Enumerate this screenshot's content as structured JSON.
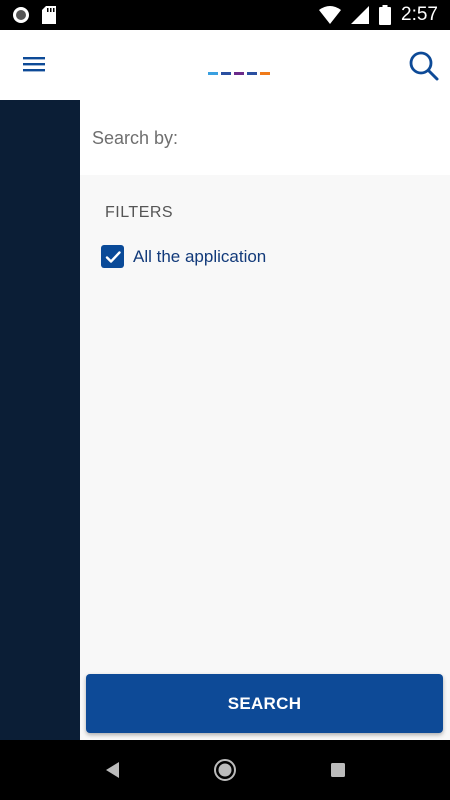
{
  "status_bar": {
    "time": "2:57"
  },
  "app_bar": {
    "logo_colors": [
      "#3aa0e0",
      "#2a4fa0",
      "#6b2a8a",
      "#2a4fa0",
      "#f07b1a"
    ]
  },
  "search": {
    "search_by_label": "Search by:"
  },
  "filters": {
    "title": "FILTERS",
    "items": [
      {
        "label": "All the application",
        "checked": true
      }
    ]
  },
  "actions": {
    "search_button_label": "SEARCH"
  },
  "colors": {
    "primary": "#0d4a97",
    "side_panel": "#0b1e36",
    "label_text": "#123a7a"
  }
}
